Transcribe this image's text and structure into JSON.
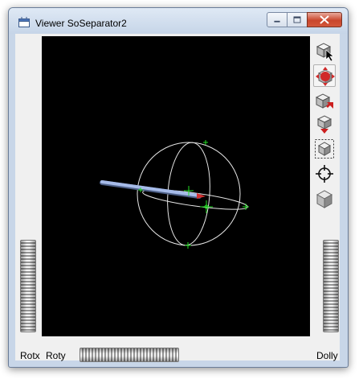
{
  "window": {
    "title": "Viewer SoSeparator2"
  },
  "toolbar": {
    "tools": [
      {
        "icon": "select-arrow-icon",
        "active": false
      },
      {
        "icon": "view-rotate-icon",
        "active": true
      },
      {
        "icon": "home-icon",
        "active": false
      },
      {
        "icon": "set-home-icon",
        "active": false
      },
      {
        "icon": "view-all-icon",
        "active": false
      },
      {
        "icon": "seek-crosshair-icon",
        "active": false
      },
      {
        "icon": "perspective-cube-icon",
        "active": false
      }
    ]
  },
  "thumbwheels": {
    "rotx_label": "Rotx",
    "roty_label": "Roty",
    "dolly_label": "Dolly"
  },
  "colors": {
    "viewport_background": "#000000",
    "sphere_wireframe": "#e6e6e6",
    "handle_green": "#22dd22",
    "needle_blue": "#9db4e8",
    "needle_red": "#d23030",
    "close_button": "#c9462c"
  }
}
